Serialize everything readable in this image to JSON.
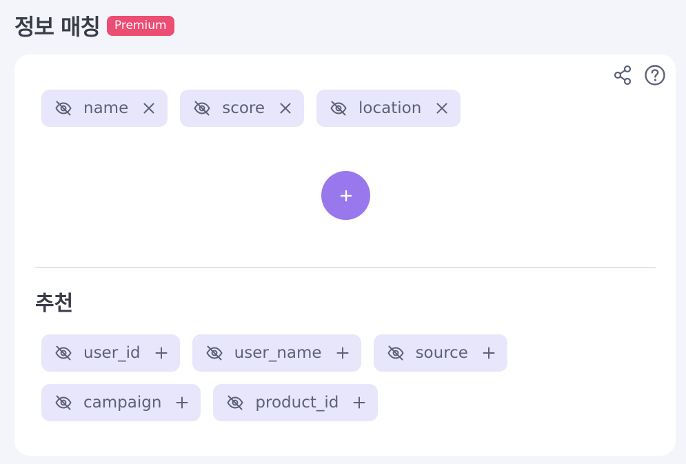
{
  "header": {
    "title": "정보 매칭",
    "badge": "Premium"
  },
  "card": {
    "icons": {
      "share": "share-icon",
      "help": "help-circle-icon"
    },
    "selected_fields": [
      {
        "label": "name",
        "icon": "eye-off-icon",
        "action": "remove"
      },
      {
        "label": "score",
        "icon": "eye-off-icon",
        "action": "remove"
      },
      {
        "label": "location",
        "icon": "eye-off-icon",
        "action": "remove"
      }
    ],
    "add_button": {
      "label": "+"
    },
    "recommend": {
      "title": "추천",
      "rows": [
        [
          {
            "label": "user_id",
            "icon": "eye-off-icon",
            "action": "add"
          },
          {
            "label": "user_name",
            "icon": "eye-off-icon",
            "action": "add"
          },
          {
            "label": "source",
            "icon": "eye-off-icon",
            "action": "add"
          }
        ],
        [
          {
            "label": "campaign",
            "icon": "eye-off-icon",
            "action": "add"
          },
          {
            "label": "product_id",
            "icon": "eye-off-icon",
            "action": "add"
          }
        ]
      ]
    }
  },
  "colors": {
    "background": "#f3f5fa",
    "card": "#ffffff",
    "chip": "#e8e6fb",
    "chip_text": "#5d6178",
    "badge": "#ec4d72",
    "accent": "#9878ec",
    "title_text": "#3a3d48"
  }
}
